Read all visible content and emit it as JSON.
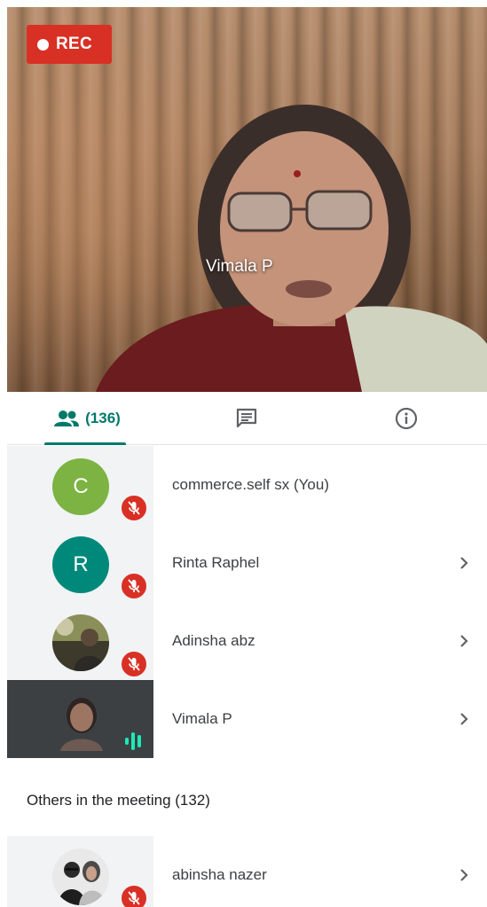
{
  "video": {
    "rec_label": "REC",
    "speaker_name": "Vimala P"
  },
  "tabs": {
    "people_count": "(136)",
    "active": "people"
  },
  "participants": [
    {
      "initial": "C",
      "name": "commerce.self sx (You)",
      "avatar_color": "#7cb342",
      "muted": true,
      "has_chevron": false
    },
    {
      "initial": "R",
      "name": "Rinta Raphel",
      "avatar_color": "#00897b",
      "muted": true,
      "has_chevron": true
    },
    {
      "initial": "",
      "name": "Adinsha abz",
      "avatar": "photo",
      "muted": true,
      "has_chevron": true
    },
    {
      "initial": "",
      "name": "Vimala P",
      "avatar": "photo",
      "muted": false,
      "speaking": true,
      "has_chevron": true
    }
  ],
  "others": {
    "header": "Others in the meeting (132)",
    "participants": [
      {
        "initial": "",
        "name": "abinsha nazer",
        "avatar": "photo",
        "muted": true,
        "has_chevron": true
      }
    ]
  },
  "colors": {
    "accent": "#00796b",
    "mute_red": "#d93025",
    "speaking_green": "#1de9b6"
  }
}
